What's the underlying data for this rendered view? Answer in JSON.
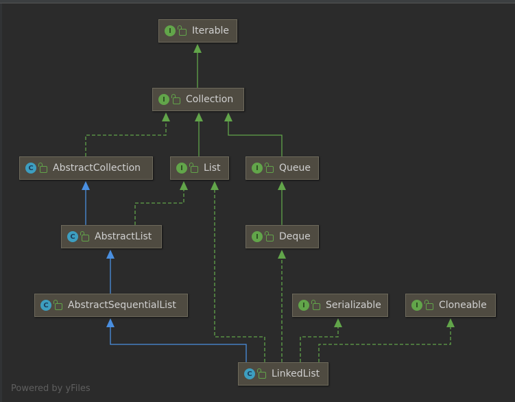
{
  "nodes": [
    {
      "id": "iterable",
      "label": "Iterable",
      "kind": "I"
    },
    {
      "id": "collection",
      "label": "Collection",
      "kind": "I"
    },
    {
      "id": "abstractcollection",
      "label": "AbstractCollection",
      "kind": "C"
    },
    {
      "id": "list",
      "label": "List",
      "kind": "I"
    },
    {
      "id": "queue",
      "label": "Queue",
      "kind": "I"
    },
    {
      "id": "abstractlist",
      "label": "AbstractList",
      "kind": "C"
    },
    {
      "id": "deque",
      "label": "Deque",
      "kind": "I"
    },
    {
      "id": "abstractsequentiallist",
      "label": "AbstractSequentialList",
      "kind": "C"
    },
    {
      "id": "serializable",
      "label": "Serializable",
      "kind": "I"
    },
    {
      "id": "cloneable",
      "label": "Cloneable",
      "kind": "I"
    },
    {
      "id": "linkedlist",
      "label": "LinkedList",
      "kind": "C"
    }
  ],
  "edges": [
    {
      "from": "collection",
      "to": "iterable",
      "type": "extends-interface"
    },
    {
      "from": "abstractcollection",
      "to": "collection",
      "type": "implements"
    },
    {
      "from": "list",
      "to": "collection",
      "type": "extends-interface"
    },
    {
      "from": "queue",
      "to": "collection",
      "type": "extends-interface"
    },
    {
      "from": "abstractlist",
      "to": "abstractcollection",
      "type": "extends-class"
    },
    {
      "from": "abstractlist",
      "to": "list",
      "type": "implements"
    },
    {
      "from": "deque",
      "to": "queue",
      "type": "extends-interface"
    },
    {
      "from": "abstractsequentiallist",
      "to": "abstractlist",
      "type": "extends-class"
    },
    {
      "from": "linkedlist",
      "to": "abstractsequentiallist",
      "type": "extends-class"
    },
    {
      "from": "linkedlist",
      "to": "list",
      "type": "implements"
    },
    {
      "from": "linkedlist",
      "to": "deque",
      "type": "implements"
    },
    {
      "from": "linkedlist",
      "to": "serializable",
      "type": "implements"
    },
    {
      "from": "linkedlist",
      "to": "cloneable",
      "type": "implements"
    }
  ],
  "colors": {
    "background": "#2b2b2b",
    "interface_edge": "#62a54a",
    "class_edge": "#4a8fe0",
    "node_fill": "#4f4b41"
  },
  "footer": "Powered by yFiles"
}
